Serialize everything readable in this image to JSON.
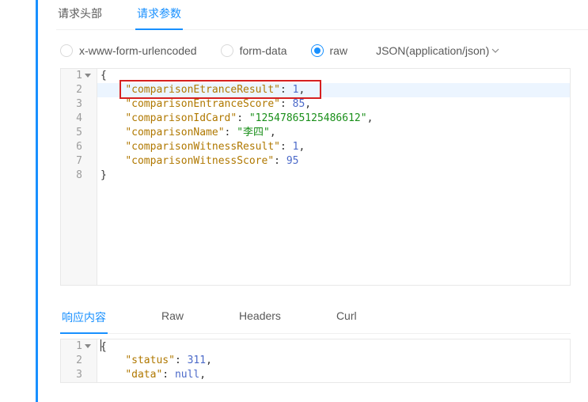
{
  "topTabs": {
    "headers": "请求头部",
    "params": "请求参数"
  },
  "bodyTypes": {
    "urlencoded": "x-www-form-urlencoded",
    "formdata": "form-data",
    "raw": "raw"
  },
  "contentType": "JSON(application/json)",
  "requestBody": {
    "line1": "{",
    "l2_key": "\"comparisonEtranceResult\"",
    "l2_val": "1",
    "l3_key": "\"comparisonEntranceScore\"",
    "l3_val": "85",
    "l4_key": "\"comparisonIdCard\"",
    "l4_val": "\"12547865125486612\"",
    "l5_key": "\"comparisonName\"",
    "l5_val": "\"李四\"",
    "l6_key": "\"comparisonWitnessResult\"",
    "l6_val": "1",
    "l7_key": "\"comparisonWitnessScore\"",
    "l7_val": "95",
    "line8": "}"
  },
  "respTabs": {
    "content": "响应内容",
    "raw": "Raw",
    "headers": "Headers",
    "curl": "Curl"
  },
  "responseBody": {
    "line1": "{",
    "l2_key": "\"status\"",
    "l2_val": "311",
    "l3_key": "\"data\"",
    "l3_val": "null"
  },
  "gutter1": {
    "1": "1",
    "2": "2",
    "3": "3",
    "4": "4",
    "5": "5",
    "6": "6",
    "7": "7",
    "8": "8"
  },
  "gutter2": {
    "1": "1",
    "2": "2",
    "3": "3"
  }
}
